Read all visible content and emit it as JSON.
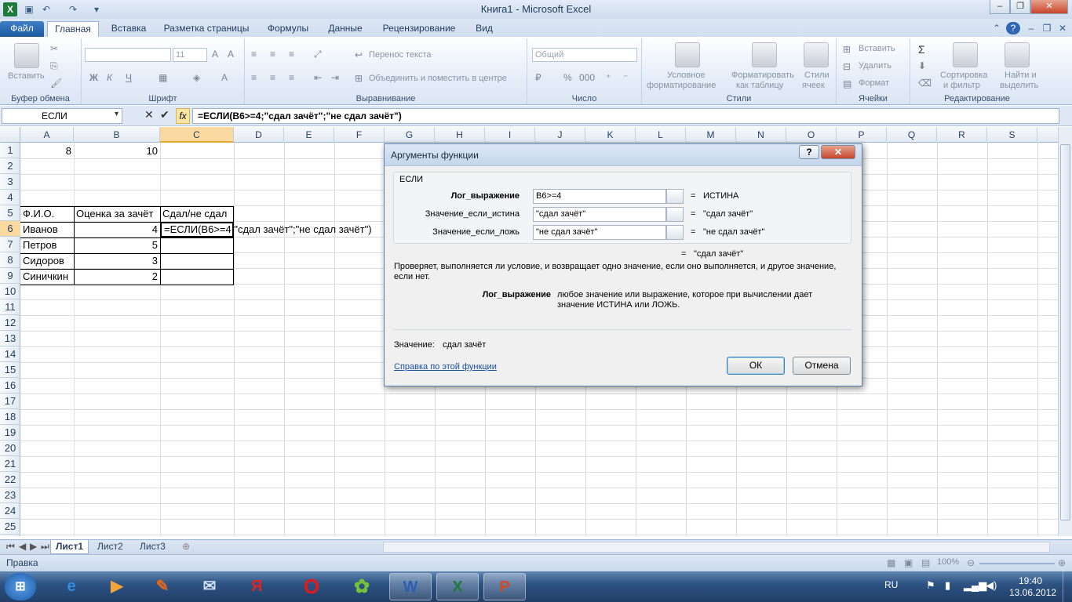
{
  "window": {
    "title": "Книга1 - Microsoft Excel"
  },
  "ribbon_tabs": [
    "Файл",
    "Главная",
    "Вставка",
    "Разметка страницы",
    "Формулы",
    "Данные",
    "Рецензирование",
    "Вид"
  ],
  "ribbon": {
    "paste_label": "Вставить",
    "groups": [
      "Буфер обмена",
      "Шрифт",
      "Выравнивание",
      "Число",
      "Стили",
      "Ячейки",
      "Редактирование"
    ],
    "font_size": "11",
    "bold": "Ж",
    "italic": "К",
    "underline": "Ч",
    "wrap_text": "Перенос текста",
    "merge_center": "Объединить и поместить в центре",
    "number_format": "Общий",
    "cond_format_1": "Условное",
    "cond_format_2": "форматирование",
    "format_table_1": "Форматировать",
    "format_table_2": "как таблицу",
    "cell_styles_1": "Стили",
    "cell_styles_2": "ячеек",
    "insert_cells": "Вставить",
    "delete_cells": "Удалить",
    "format_cells": "Формат",
    "sort_1": "Сортировка",
    "sort_2": "и фильтр",
    "find_1": "Найти и",
    "find_2": "выделить"
  },
  "formula_bar": {
    "name_box": "ЕСЛИ",
    "fx": "fx",
    "formula": "=ЕСЛИ(B6>=4;\"сдал зачёт\";\"не сдал зачёт\")"
  },
  "columns": [
    "A",
    "B",
    "C",
    "D",
    "E",
    "F",
    "G",
    "H",
    "I",
    "J",
    "K",
    "L",
    "M",
    "N",
    "O",
    "P",
    "Q",
    "R",
    "S"
  ],
  "rows": [
    "1",
    "2",
    "3",
    "4",
    "5",
    "6",
    "7",
    "8",
    "9",
    "10",
    "11",
    "12",
    "13",
    "14",
    "15",
    "16",
    "17",
    "18",
    "19",
    "20",
    "21",
    "22",
    "23",
    "24",
    "25"
  ],
  "cells": {
    "a1": "8",
    "b1": "10",
    "a5": "Ф.И.О.",
    "b5": "Оценка за зачёт",
    "c5": "Сдал/не сдал",
    "a6": "Иванов",
    "b6": "4",
    "c6": "=ЕСЛИ(B6>=4;\"сдал зачёт\";\"не сдал зачёт\")",
    "a7": "Петров",
    "b7": "5",
    "a8": "Сидоров",
    "b8": "3",
    "a9": "Синичкин",
    "b9": "2"
  },
  "dialog": {
    "title": "Аргументы функции",
    "function": "ЕСЛИ",
    "args": [
      {
        "label": "Лог_выражение",
        "value": "B6>=4",
        "result": "ИСТИНА"
      },
      {
        "label": "Значение_если_истина",
        "value": "\"сдал зачёт\"",
        "result": "\"сдал зачёт\""
      },
      {
        "label": "Значение_если_ложь",
        "value": "\"не сдал зачёт\"",
        "result": "\"не сдал зачёт\""
      }
    ],
    "overall_result": "\"сдал зачёт\"",
    "equals": "=",
    "description": "Проверяет, выполняется ли условие, и возвращает одно значение, если оно выполняется, и другое значение, если нет.",
    "arg_desc_name": "Лог_выражение",
    "arg_desc": "любое значение или выражение, которое при вычислении дает значение ИСТИНА или ЛОЖЬ.",
    "value_label": "Значение:",
    "value": "сдал зачёт",
    "help_link": "Справка по этой функции",
    "ok": "ОК",
    "cancel": "Отмена",
    "help_btn": "?",
    "close_btn": "✕"
  },
  "sheet_tabs": [
    "Лист1",
    "Лист2",
    "Лист3"
  ],
  "status": {
    "mode": "Правка",
    "zoom": "100%"
  },
  "taskbar": {
    "lang": "RU",
    "time": "19:40",
    "date": "13.06.2012"
  },
  "icons": [
    "excel-app-icon",
    "save-icon",
    "undo-icon",
    "redo-icon",
    "help-icon",
    "close-icon",
    "start-icon",
    "ie-icon",
    "media-player-icon",
    "icq-icon",
    "word-icon",
    "excel-icon",
    "powerpoint-icon",
    "opera-icon",
    "yandex-icon"
  ]
}
